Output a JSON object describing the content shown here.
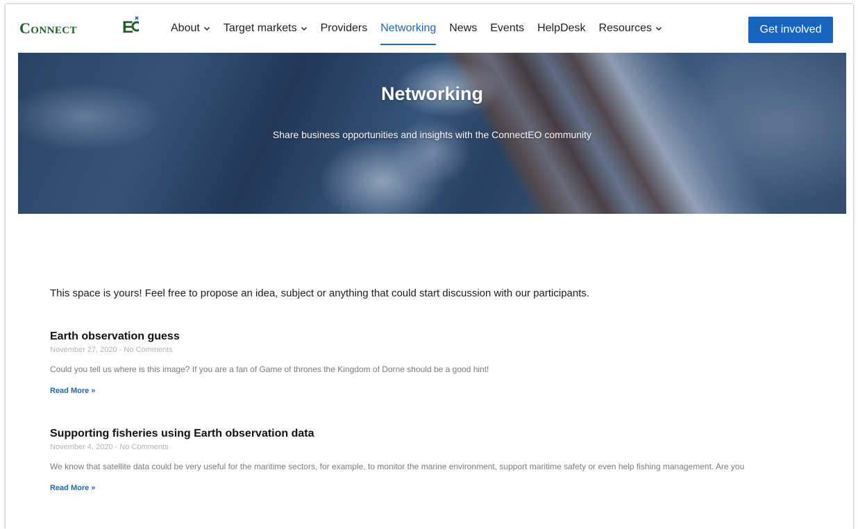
{
  "brand": {
    "logo_text": "Connect",
    "logo_eo": "EO",
    "accent": "#1e66b3",
    "logo_color": "#1f5d2b"
  },
  "nav": {
    "items": [
      {
        "label": "About",
        "dropdown": true,
        "active": false
      },
      {
        "label": "Target markets",
        "dropdown": true,
        "active": false
      },
      {
        "label": "Providers",
        "dropdown": false,
        "active": false
      },
      {
        "label": "Networking",
        "dropdown": false,
        "active": true
      },
      {
        "label": "News",
        "dropdown": false,
        "active": false
      },
      {
        "label": "Events",
        "dropdown": false,
        "active": false
      },
      {
        "label": "HelpDesk",
        "dropdown": false,
        "active": false
      },
      {
        "label": "Resources",
        "dropdown": true,
        "active": false
      }
    ],
    "cta_label": "Get involved"
  },
  "hero": {
    "title": "Networking",
    "subtitle": "Share business opportunities and insights with the ConnectEO community"
  },
  "intro": "This space is yours! Feel free to propose an idea, subject or anything that could start discussion with our participants.",
  "posts": [
    {
      "title": "Earth observation guess",
      "meta": "November 27, 2020 - No Comments",
      "excerpt": "Could you tell us where is this image? If you are a fan of Game of thrones the Kingdom of Dorne should be a good hint!",
      "read_more": "Read More »"
    },
    {
      "title": "Supporting fisheries using Earth observation data",
      "meta": "November 4, 2020 - No Comments",
      "excerpt": "We know that satellite data could be very useful for the maritime sectors, for example, to monitor the marine environment, support maritime safety or even help fishing management. Are you",
      "read_more": "Read More »"
    }
  ]
}
